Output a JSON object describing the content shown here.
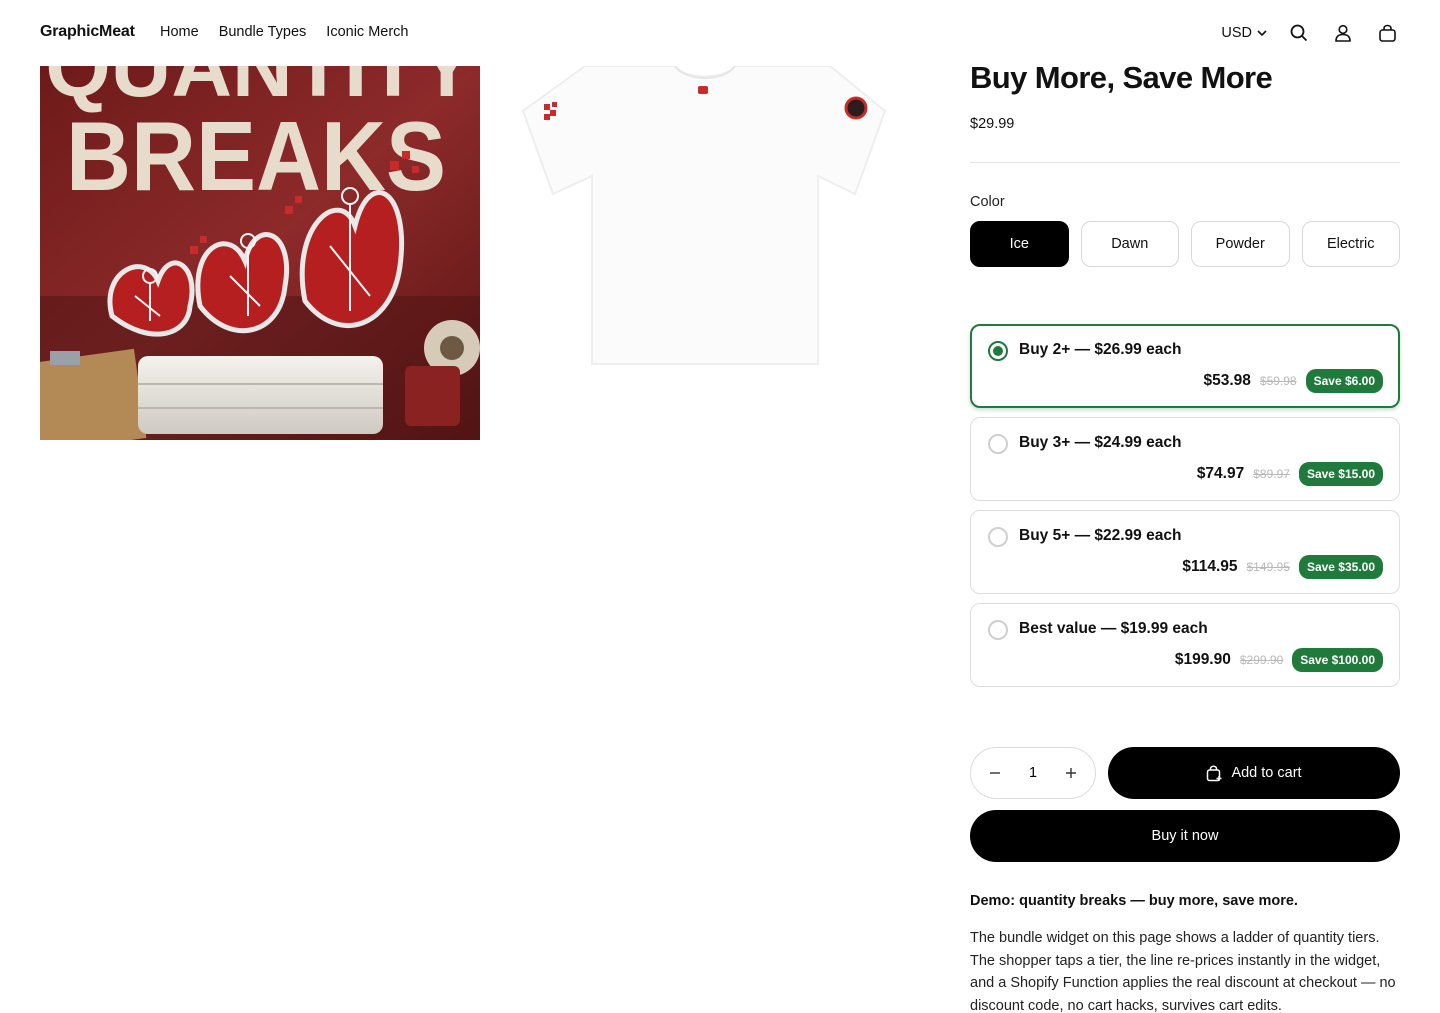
{
  "header": {
    "logo": "GraphicMeat",
    "nav": [
      "Home",
      "Bundle Types",
      "Iconic Merch"
    ],
    "currency": "USD"
  },
  "media": {
    "hero_text_top": "QUANTITY",
    "hero_text_bottom": "BREAKS"
  },
  "product": {
    "title": "Buy More, Save More",
    "price": "$29.99",
    "color_label": "Color",
    "colors": [
      "Ice",
      "Dawn",
      "Powder",
      "Electric"
    ],
    "selected_color": "Ice"
  },
  "tiers": [
    {
      "label": "Buy 2+ — $26.99 each",
      "total": "$53.98",
      "compare": "$59.98",
      "save": "Save $6.00",
      "selected": true
    },
    {
      "label": "Buy 3+ — $24.99 each",
      "total": "$74.97",
      "compare": "$89.97",
      "save": "Save $15.00",
      "selected": false
    },
    {
      "label": "Buy 5+ — $22.99 each",
      "total": "$114.95",
      "compare": "$149.95",
      "save": "Save $35.00",
      "selected": false
    },
    {
      "label": "Best value — $19.99 each",
      "total": "$199.90",
      "compare": "$299.90",
      "save": "Save $100.00",
      "selected": false
    }
  ],
  "cart": {
    "quantity": "1",
    "add_to_cart": "Add to cart",
    "buy_now": "Buy it now"
  },
  "description": {
    "heading": "Demo: quantity breaks — buy more, save more.",
    "body": "The bundle widget on this page shows a ladder of quantity tiers. The shopper taps a tier, the line re-prices instantly in the widget, and a Shopify Function applies the real discount at checkout — no discount code, no cart hacks, survives cart edits."
  },
  "colors": {
    "accent_green": "#1f7a3c",
    "hero_red": "#7d1f1f",
    "button_black": "#000000"
  }
}
